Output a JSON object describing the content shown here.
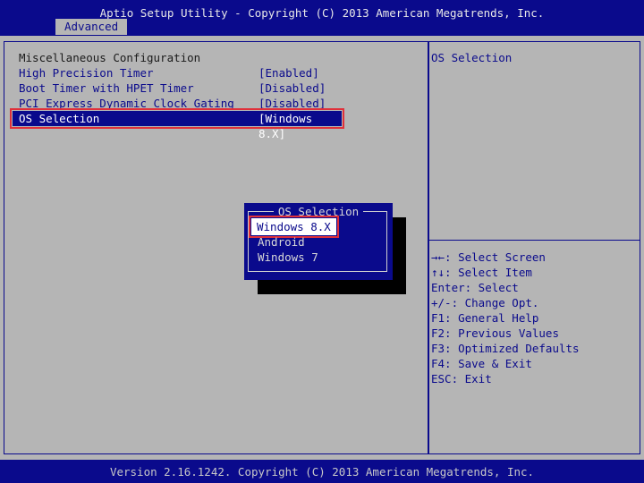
{
  "header": {
    "title": "Aptio Setup Utility - Copyright (C) 2013 American Megatrends, Inc.",
    "active_tab": "Advanced"
  },
  "main": {
    "section_title": "Miscellaneous Configuration",
    "settings": [
      {
        "label": "High Precision Timer",
        "value": "[Enabled]"
      },
      {
        "label": "Boot Timer with HPET Timer",
        "value": "[Disabled]"
      },
      {
        "label": "PCI Express Dynamic Clock Gating",
        "value": "[Disabled]"
      },
      {
        "label": "OS Selection",
        "value": "[Windows 8.X]"
      }
    ]
  },
  "help": {
    "title": "OS Selection",
    "keys": [
      "→←: Select Screen",
      "↑↓: Select Item",
      "Enter: Select",
      "+/-: Change Opt.",
      "F1: General Help",
      "F2: Previous Values",
      "F3: Optimized Defaults",
      "F4: Save & Exit",
      "ESC: Exit"
    ]
  },
  "popup": {
    "title": "OS Selection",
    "options": [
      "Windows 8.X",
      "Android",
      "Windows 7"
    ],
    "selected_index": 0
  },
  "footer": {
    "text": "Version 2.16.1242. Copyright (C) 2013 American Megatrends, Inc."
  },
  "colors": {
    "background": "#b5b5b5",
    "bar_blue": "#0a0a8c",
    "highlight_red": "#e0303a"
  }
}
